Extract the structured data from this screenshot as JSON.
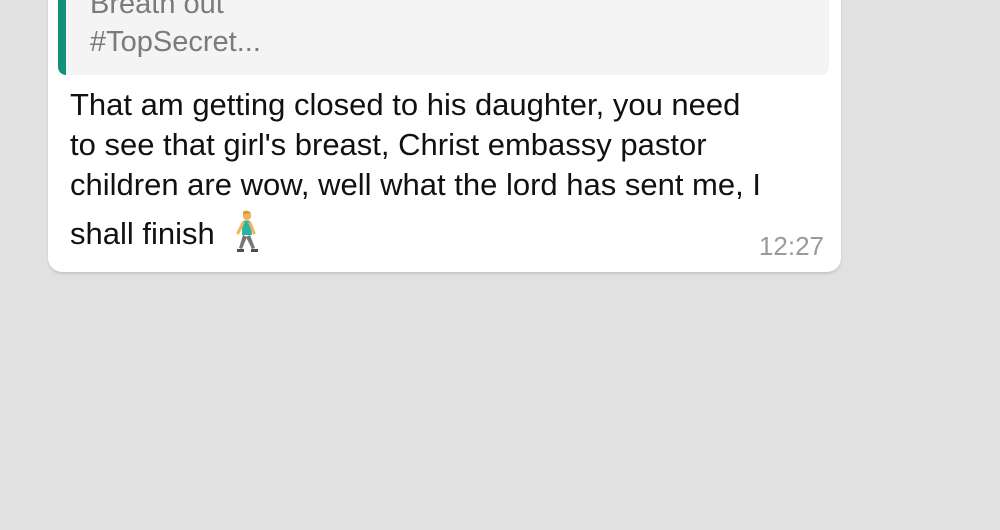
{
  "chat": {
    "quoted_message": {
      "line1": "Breath out",
      "line2": "#TopSecret..."
    },
    "message": {
      "line1": "That am getting closed to his daughter, you need",
      "line2": "to see that girl's breast, Christ embassy pastor",
      "line3": "children are wow, well what the lord has sent me, I",
      "line4": "shall finish",
      "emoji": "person-walking-icon"
    },
    "time": "12:27"
  },
  "colors": {
    "background": "#e1e1e1",
    "bubble": "#ffffff",
    "quote_background": "#f4f4f4",
    "quote_accent": "#12907c",
    "time_text": "#9a9a9a"
  }
}
